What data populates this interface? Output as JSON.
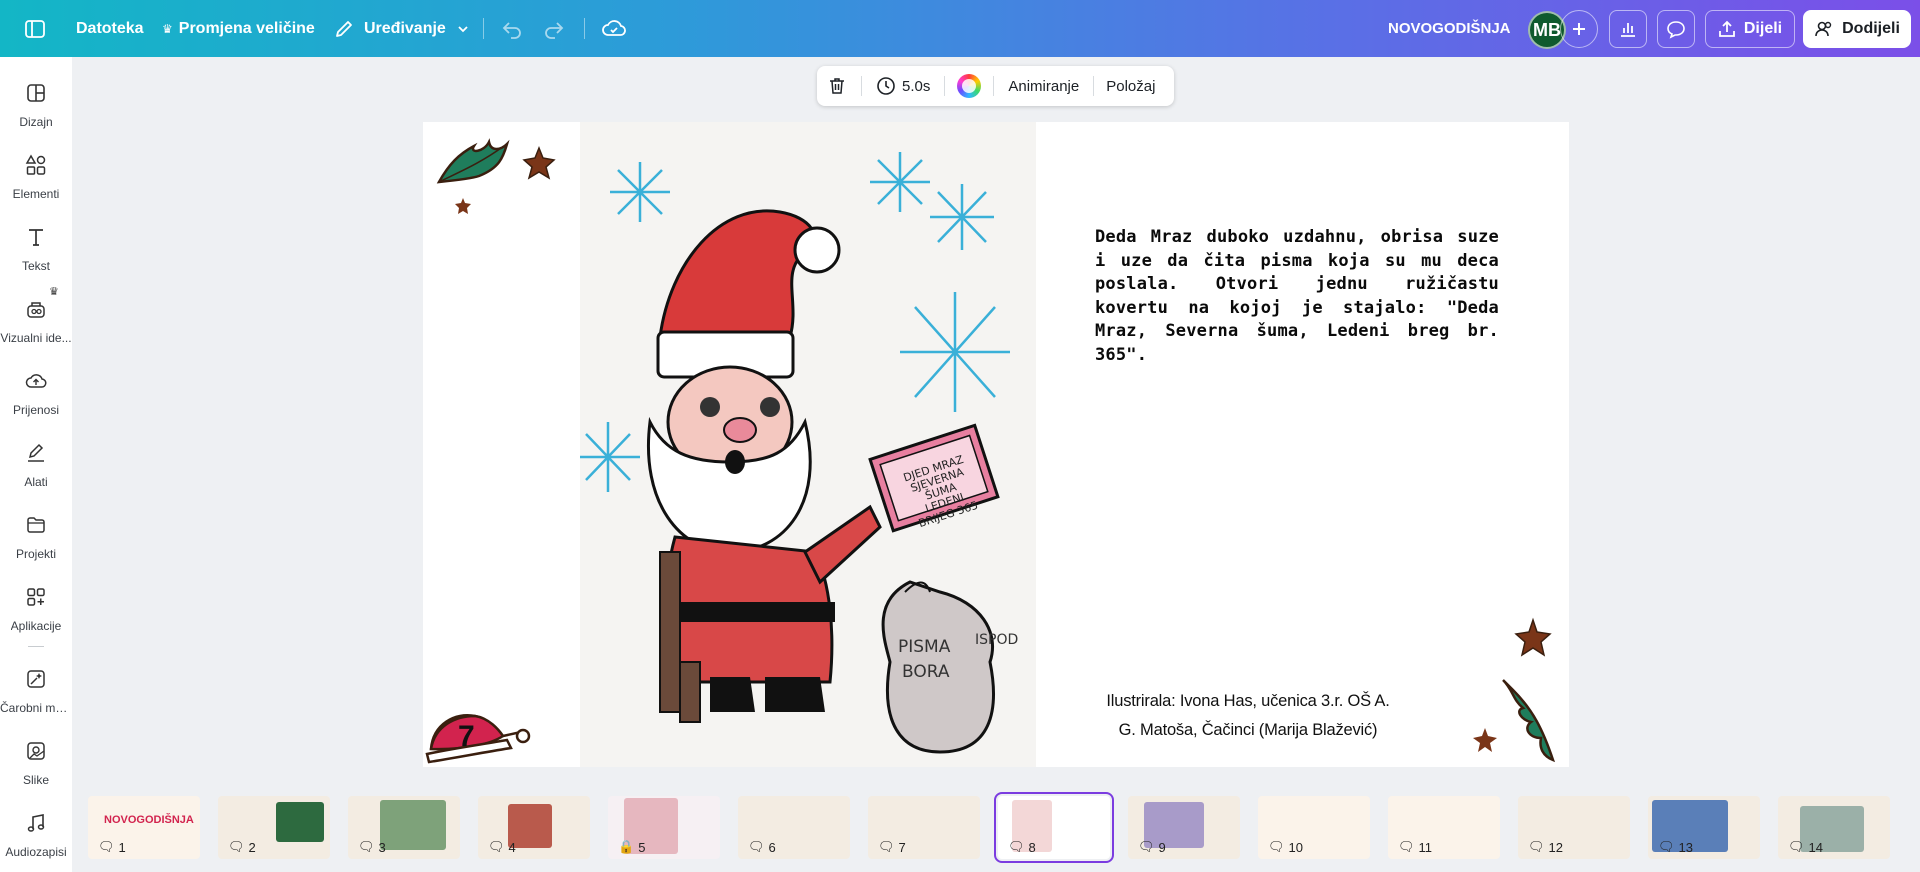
{
  "topbar": {
    "file_label": "Datoteka",
    "resize_label": "Promjena veličine",
    "edit_label": "Uređivanje",
    "title": "NOVOGODIŠNJA",
    "avatar_initials": "MB",
    "share_label": "Dijeli",
    "assign_label": "Dodijeli"
  },
  "sidebar": {
    "items": [
      {
        "label": "Dizajn",
        "icon": "layout-icon"
      },
      {
        "label": "Elementi",
        "icon": "shapes-icon"
      },
      {
        "label": "Tekst",
        "icon": "text-icon"
      },
      {
        "label": "Vizualni ide...",
        "icon": "ideas-icon"
      },
      {
        "label": "Prijenosi",
        "icon": "upload-cloud-icon"
      },
      {
        "label": "Alati",
        "icon": "pen-icon"
      },
      {
        "label": "Projekti",
        "icon": "folder-icon"
      },
      {
        "label": "Aplikacije",
        "icon": "apps-icon"
      },
      {
        "label": "Čarobni mu...",
        "icon": "magic-icon"
      },
      {
        "label": "Slike",
        "icon": "image-icon"
      },
      {
        "label": "Audiozapisi",
        "icon": "music-icon"
      }
    ]
  },
  "float_toolbar": {
    "duration": "5.0s",
    "animate_label": "Animiranje",
    "position_label": "Položaj"
  },
  "slide": {
    "story_text": "Deda Mraz duboko uzdahnu, obrisa suze i uze da čita pisma koja su mu deca poslala. Otvori jednu ružičastu kovertu na kojoj je stajalo: \"Deda Mraz, Severna šuma, Ledeni breg br. 365\".",
    "credit_line1": "Ilustrirala: Ivona Has, učenica 3.r. OŠ A.",
    "credit_line2": "G. Matoša, Čačinci (Marija Blažević)",
    "page_number": "7",
    "letter_text": "DJED MRAZ SJEVERNA ŠUMA LEDENI BRIJEG 365",
    "sack_text_1": "PISMA",
    "sack_text_2": "ISPOD",
    "sack_text_3": "BORA"
  },
  "thumbnails": [
    {
      "num": "1",
      "title": "NOVOGODIŠNJA"
    },
    {
      "num": "2"
    },
    {
      "num": "3"
    },
    {
      "num": "4"
    },
    {
      "num": "5"
    },
    {
      "num": "6"
    },
    {
      "num": "7"
    },
    {
      "num": "8"
    },
    {
      "num": "9"
    },
    {
      "num": "10"
    },
    {
      "num": "11"
    },
    {
      "num": "12"
    },
    {
      "num": "13"
    },
    {
      "num": "14"
    }
  ],
  "colors": {
    "brand_gradient_start": "#13b6c6",
    "brand_gradient_end": "#7b4fe8",
    "active_thumb": "#7b3ce0",
    "avatar_bg": "#0f5a2e"
  }
}
